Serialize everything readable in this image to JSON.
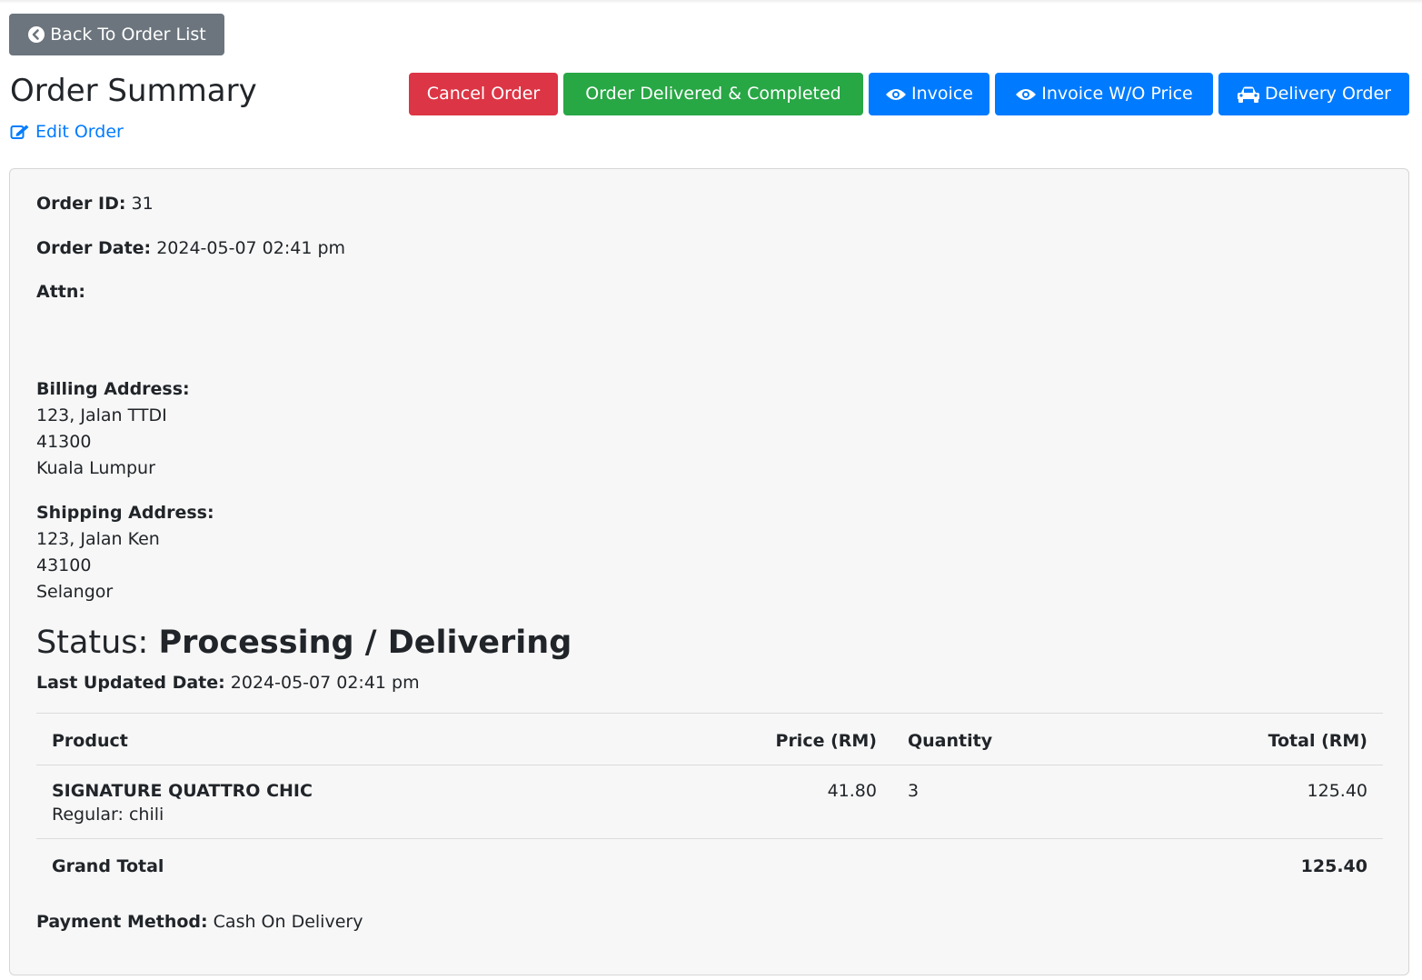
{
  "nav": {
    "back_label": "Back To Order List"
  },
  "header": {
    "title": "Order Summary",
    "edit_label": "Edit Order",
    "actions": {
      "cancel": "Cancel Order",
      "complete": "Order Delivered & Completed",
      "invoice": "Invoice",
      "invoice_wo_price": "Invoice W/O Price",
      "delivery_order": "Delivery Order"
    }
  },
  "order": {
    "id_label": "Order ID:",
    "id": "31",
    "date_label": "Order Date:",
    "date": "2024-05-07 02:41 pm",
    "attn_label": "Attn:",
    "billing_label": "Billing Address:",
    "billing": [
      "123, Jalan TTDI",
      "41300",
      "Kuala Lumpur"
    ],
    "shipping_label": "Shipping Address:",
    "shipping": [
      "123, Jalan Ken",
      "43100",
      "Selangor"
    ],
    "status_label": "Status:",
    "status": "Processing / Delivering",
    "updated_label": "Last Updated Date:",
    "updated": "2024-05-07 02:41 pm",
    "payment_label": "Payment Method:",
    "payment": "Cash On Delivery"
  },
  "table": {
    "headers": {
      "product": "Product",
      "price": "Price (RM)",
      "quantity": "Quantity",
      "total": "Total (RM)"
    },
    "rows": [
      {
        "product": "SIGNATURE QUATTRO CHIC",
        "variant": "Regular: chili",
        "price": "41.80",
        "quantity": "3",
        "total": "125.40"
      }
    ],
    "grand_total_label": "Grand Total",
    "grand_total": "125.40"
  },
  "colors": {
    "secondary": "#6c757d",
    "danger": "#dc3545",
    "success": "#28a745",
    "primary": "#007bff",
    "card_bg": "#f7f7f7"
  }
}
